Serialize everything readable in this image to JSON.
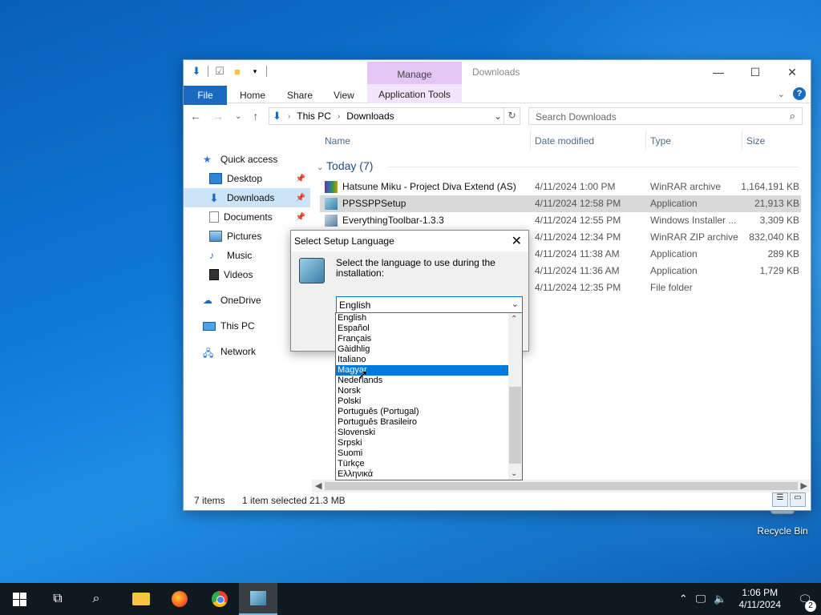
{
  "colors": {
    "accent": "#0078d7",
    "file_tab": "#1b6ac2",
    "manage_tab": "#e4c6f5",
    "taskbar": "#101820"
  },
  "desktop": {
    "recycle_bin_label": "Recycle Bin"
  },
  "explorer": {
    "title": "Downloads",
    "manage_tab": "Manage",
    "ribbon_tabs": {
      "file": "File",
      "home": "Home",
      "share": "Share",
      "view": "View",
      "app_tools": "Application Tools"
    },
    "breadcrumb": [
      "This PC",
      "Downloads"
    ],
    "search_placeholder": "Search Downloads",
    "nav_items": {
      "quick_access": "Quick access",
      "desktop": "Desktop",
      "downloads": "Downloads",
      "documents": "Documents",
      "pictures": "Pictures",
      "music": "Music",
      "videos": "Videos",
      "onedrive": "OneDrive",
      "this_pc": "This PC",
      "network": "Network"
    },
    "columns": {
      "name": "Name",
      "date": "Date modified",
      "type": "Type",
      "size": "Size"
    },
    "group_label": "Today (7)",
    "files": [
      {
        "name": "Hatsune Miku - Project Diva Extend (AS)",
        "date": "4/11/2024 1:00 PM",
        "type": "WinRAR archive",
        "size": "1,164,191 KB",
        "icon": "winrar-icon"
      },
      {
        "name": "PPSSPPSetup",
        "date": "4/11/2024 12:58 PM",
        "type": "Application",
        "size": "21,913 KB",
        "icon": "installer-icon"
      },
      {
        "name": "EverythingToolbar-1.3.3",
        "date": "4/11/2024 12:55 PM",
        "type": "Windows Installer ...",
        "size": "3,309 KB",
        "icon": "msi-icon"
      },
      {
        "name": "",
        "date": "4/11/2024 12:34 PM",
        "type": "WinRAR ZIP archive",
        "size": "832,040 KB",
        "icon": "zip-icon"
      },
      {
        "name": "",
        "date": "4/11/2024 11:38 AM",
        "type": "Application",
        "size": "289 KB",
        "icon": "app-icon"
      },
      {
        "name": "",
        "date": "4/11/2024 11:36 AM",
        "type": "Application",
        "size": "1,729 KB",
        "icon": "app-icon"
      },
      {
        "name": "",
        "date": "4/11/2024 12:35 PM",
        "type": "File folder",
        "size": "",
        "icon": "folder-icon"
      }
    ],
    "status": {
      "items": "7 items",
      "selected": "1 item selected",
      "size": "21.3 MB"
    }
  },
  "dialog": {
    "title": "Select Setup Language",
    "message": "Select the language to use during the installation:",
    "selected": "English",
    "options": [
      "English",
      "Español",
      "Français",
      "Gàidhlig",
      "Italiano",
      "Magyar",
      "Nederlands",
      "Norsk",
      "Polski",
      "Português (Portugal)",
      "Português Brasileiro",
      "Slovenski",
      "Srpski",
      "Suomi",
      "Türkçe",
      "Ελληνικά"
    ],
    "highlighted_index": 5
  },
  "taskbar": {
    "time": "1:06 PM",
    "date": "4/11/2024",
    "notification_count": "2"
  }
}
